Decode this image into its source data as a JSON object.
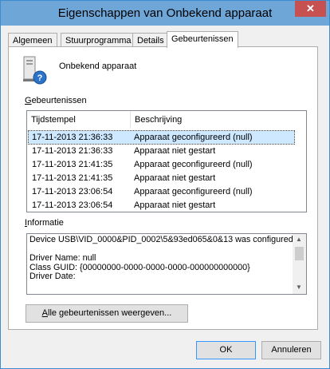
{
  "window": {
    "title": "Eigenschappen van Onbekend apparaat",
    "close_glyph": "✕"
  },
  "tabs": [
    {
      "label": "Algemeen"
    },
    {
      "label": "Stuurprogramma"
    },
    {
      "label": "Details"
    },
    {
      "label": "Gebeurtenissen",
      "active": true
    }
  ],
  "device": {
    "name": "Onbekend apparaat",
    "icon": "unknown-device-icon"
  },
  "events": {
    "group_label_first": "G",
    "group_label_rest": "ebeurtenissen",
    "columns": [
      "Tijdstempel",
      "Beschrijving"
    ],
    "rows": [
      {
        "timestamp": "17-11-2013 21:36:33",
        "description": "Apparaat geconfigureerd (null)",
        "selected": true
      },
      {
        "timestamp": "17-11-2013 21:36:33",
        "description": "Apparaat niet gestart"
      },
      {
        "timestamp": "17-11-2013 21:41:35",
        "description": "Apparaat geconfigureerd (null)"
      },
      {
        "timestamp": "17-11-2013 21:41:35",
        "description": "Apparaat niet gestart"
      },
      {
        "timestamp": "17-11-2013 23:06:54",
        "description": "Apparaat geconfigureerd (null)"
      },
      {
        "timestamp": "17-11-2013 23:06:54",
        "description": "Apparaat niet gestart"
      }
    ]
  },
  "info": {
    "label_first": "I",
    "label_rest": "nformatie",
    "lines": [
      "Device USB\\VID_0000&PID_0002\\5&93ed065&0&13 was configured.",
      "",
      "Driver Name: null",
      "Class GUID: {00000000-0000-0000-0000-000000000000}",
      "Driver Date:"
    ]
  },
  "buttons": {
    "all_events_first": "A",
    "all_events_rest": "lle gebeurtenissen weergeven...",
    "ok": "OK",
    "cancel": "Annuleren"
  },
  "colors": {
    "titlebar": "#6ea6d8",
    "close": "#c75050",
    "selection": "#cde8ff"
  }
}
